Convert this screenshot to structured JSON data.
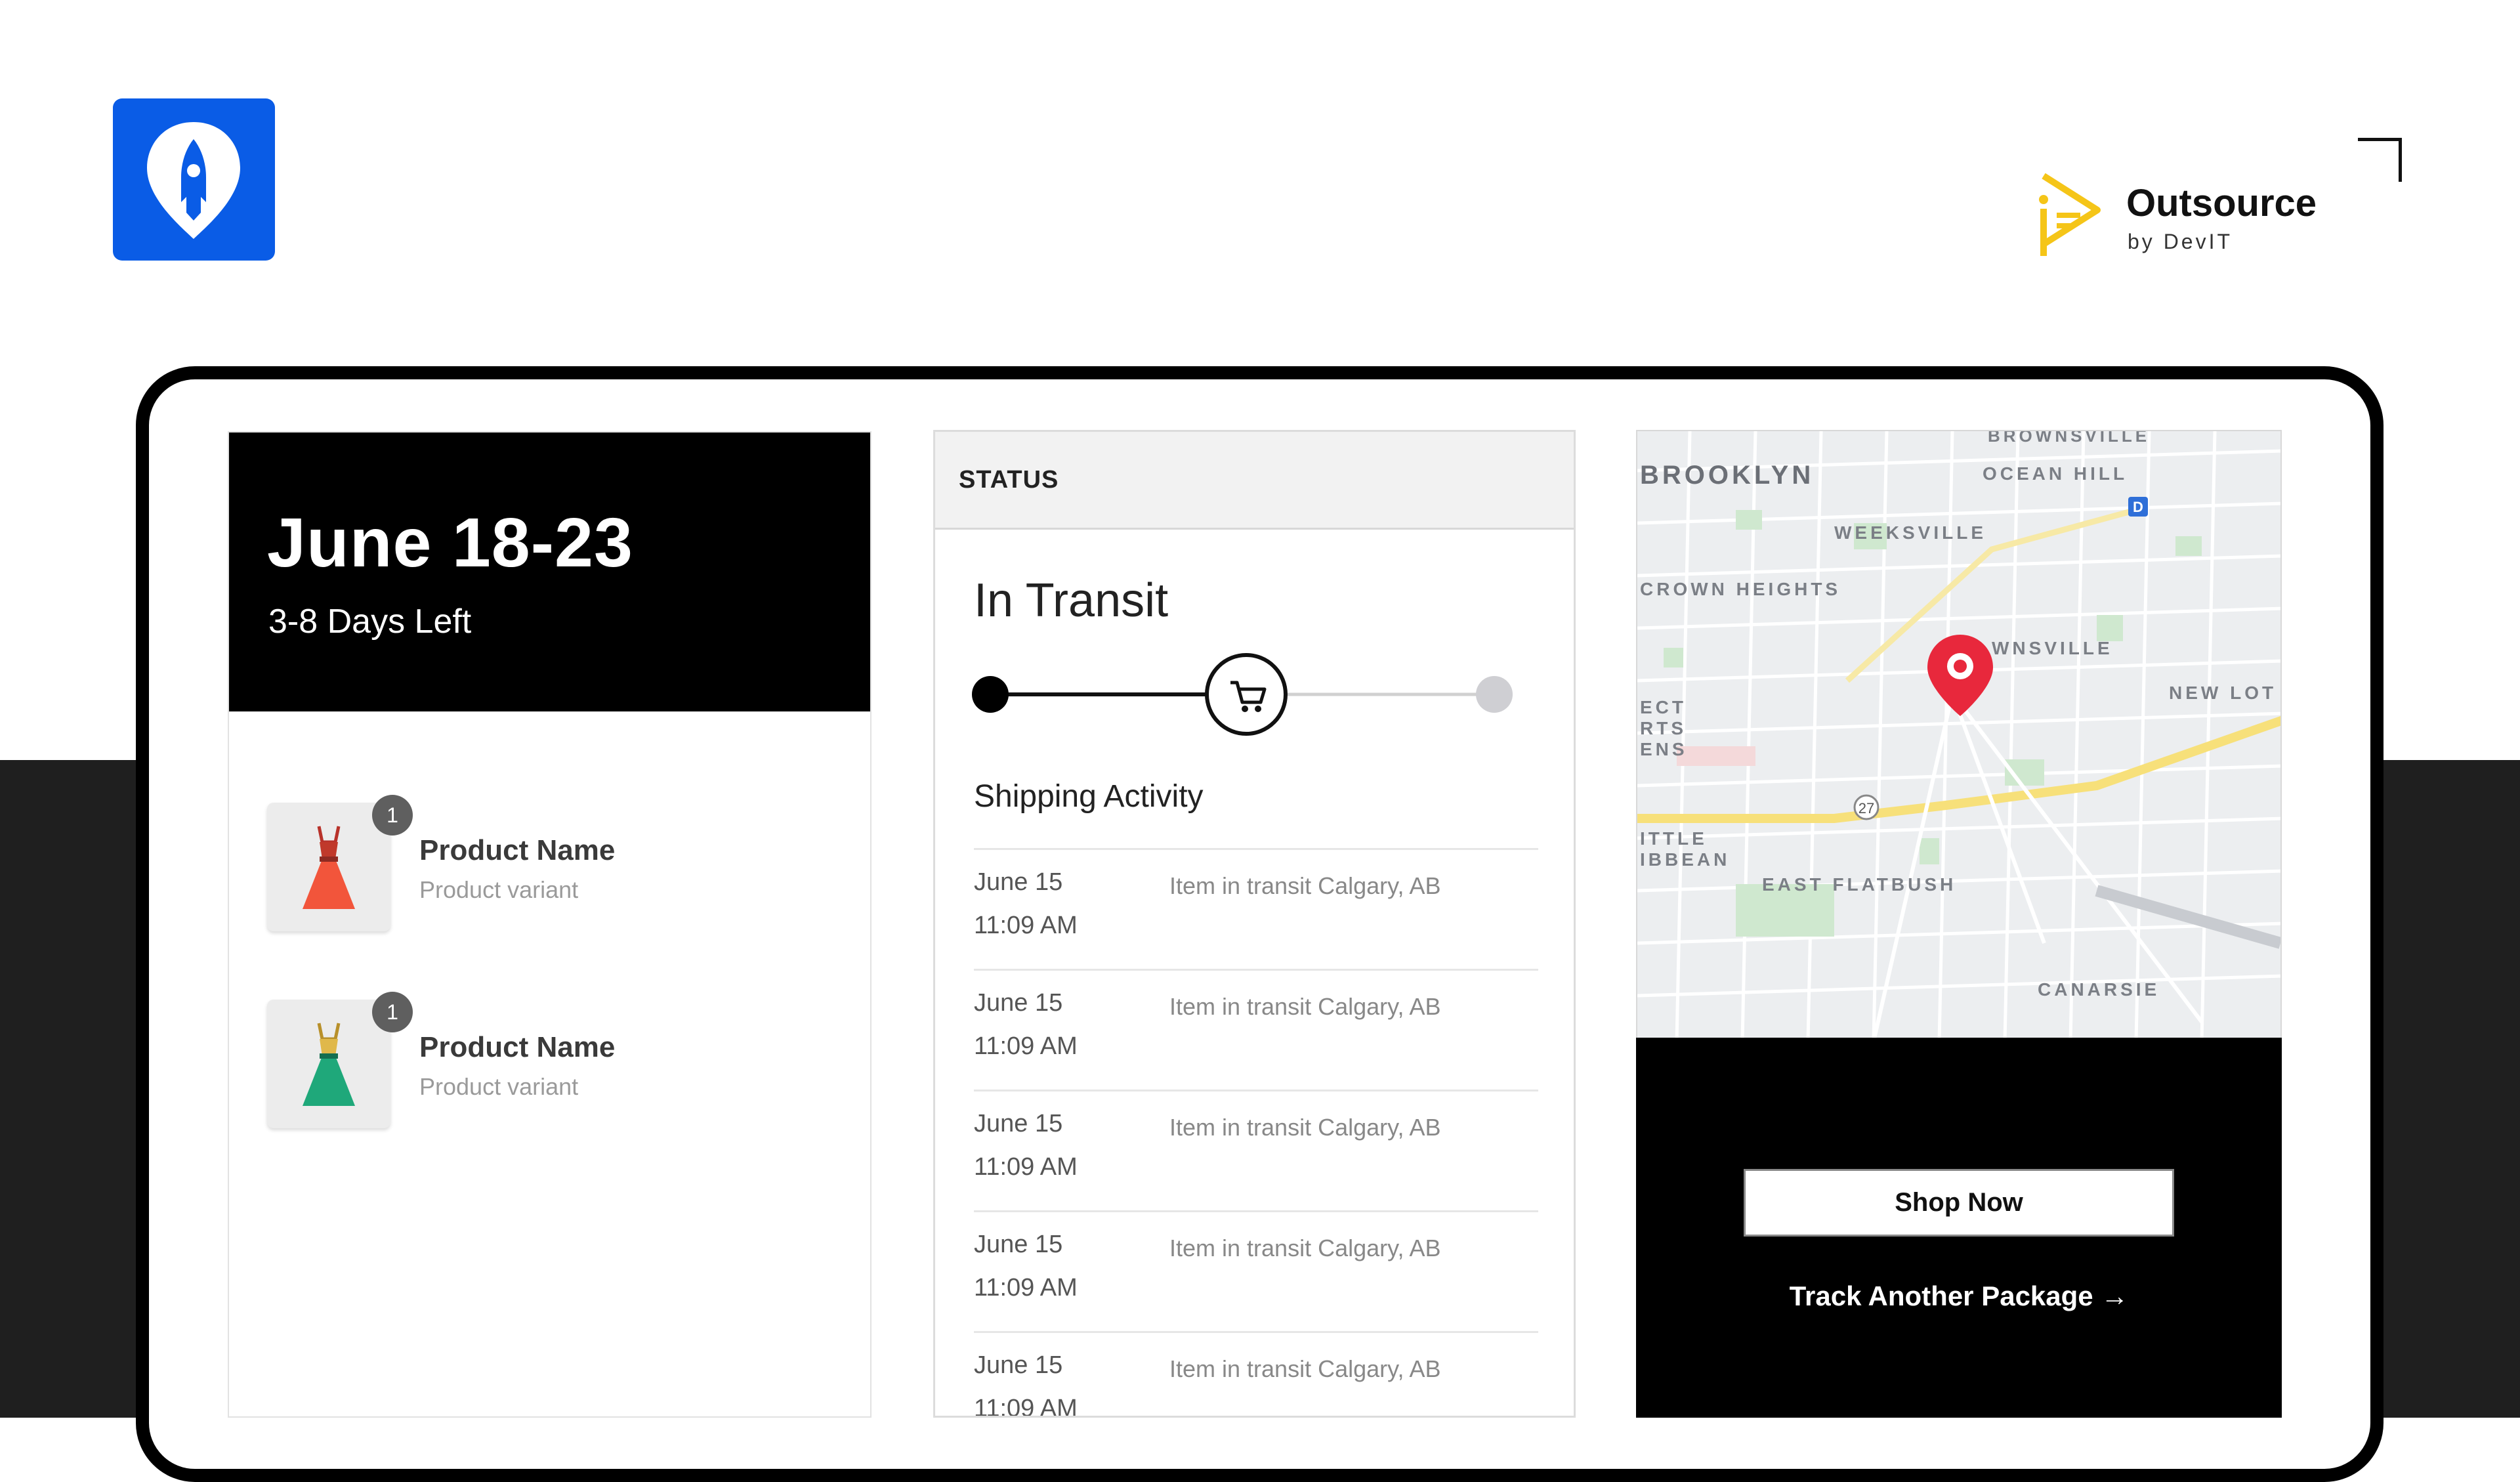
{
  "app_logo": {
    "icon": "rocket-pin-icon",
    "bg_color": "#0a5ce6"
  },
  "brand": {
    "name": "Outsource",
    "sub": "by DevIT",
    "accent_color": "#f5c518"
  },
  "order": {
    "dates": "June 18-23",
    "days_left": "3-8 Days Left",
    "products": [
      {
        "qty": "1",
        "name": "Product Name",
        "variant": "Product variant",
        "icon": "dress-icon",
        "color": "#f2553b"
      },
      {
        "qty": "1",
        "name": "Product Name",
        "variant": "Product variant",
        "icon": "dress-icon",
        "color": "#1fa87a"
      }
    ]
  },
  "status": {
    "label": "STATUS",
    "title": "In Transit",
    "progress_icon": "cart-icon",
    "progress_step": 2,
    "progress_total_steps": 3,
    "activity_title": "Shipping Activity",
    "activity": [
      {
        "date": "June 15",
        "time": "11:09 AM",
        "desc": "Item in transit Calgary, AB"
      },
      {
        "date": "June 15",
        "time": "11:09 AM",
        "desc": "Item in transit Calgary, AB"
      },
      {
        "date": "June 15",
        "time": "11:09 AM",
        "desc": "Item in transit Calgary, AB"
      },
      {
        "date": "June 15",
        "time": "11:09 AM",
        "desc": "Item in transit Calgary, AB"
      },
      {
        "date": "June 15",
        "time": "11:09 AM",
        "desc": "Item in transit Calgary, AB"
      }
    ]
  },
  "map": {
    "labels": {
      "brownsville_top": "BROWNSVILLE",
      "brooklyn": "BROOKLYN",
      "ocean_hill": "OCEAN HILL",
      "weeksville": "WEEKSVILLE",
      "crown_heights": "CROWN HEIGHTS",
      "brownsville": "WNSVILLE",
      "new_lots": "NEW LOT",
      "east_flatbush": "EAST FLATBUSH",
      "canarsie": "CANARSIE",
      "little_caribbean_1": "ITTLE",
      "little_caribbean_2": "IBBEAN",
      "prospect_1": "ECT",
      "prospect_2": "RTS",
      "prospect_3": "ENS",
      "route": "27",
      "subway": "D"
    },
    "pin_icon": "map-pin-icon",
    "pin_color": "#e8283c"
  },
  "cta": {
    "shop_now": "Shop Now",
    "track_another": "Track Another Package →"
  }
}
